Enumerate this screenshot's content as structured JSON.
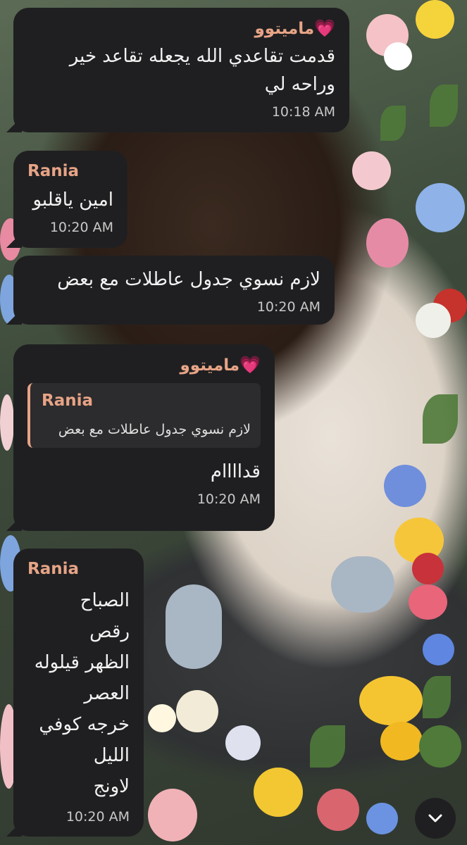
{
  "messages": [
    {
      "sender": "ماميتوو",
      "sender_emoji": "💗",
      "text": "قدمت تقاعدي الله يجعله تقاعد خير وراحه لي",
      "time": "10:18 AM"
    },
    {
      "sender": "Rania",
      "text": "امين ياقلبو",
      "time": "10:20 AM"
    },
    {
      "text": "لازم نسوي جدول عاطلات مع بعض",
      "time": "10:20 AM"
    },
    {
      "sender": "ماميتوو",
      "sender_emoji": "💗",
      "reply": {
        "name": "Rania",
        "text": "لازم نسوي جدول عاطلات مع بعض"
      },
      "text": "قداااام",
      "time": "10:20 AM"
    },
    {
      "sender": "Rania",
      "text": "الصباح\nرقص\nالظهر قيلوله\nالعصر\nخرجه كوفي\nالليل\nلاونج",
      "time": "10:20 AM"
    }
  ],
  "scroll_button": {
    "icon": "chevron-down-icon"
  },
  "colors": {
    "bubble": "#1f1f21",
    "sender_name": "#e7a486",
    "time": "#c8c8c8",
    "heart": "#ff4fb3"
  }
}
